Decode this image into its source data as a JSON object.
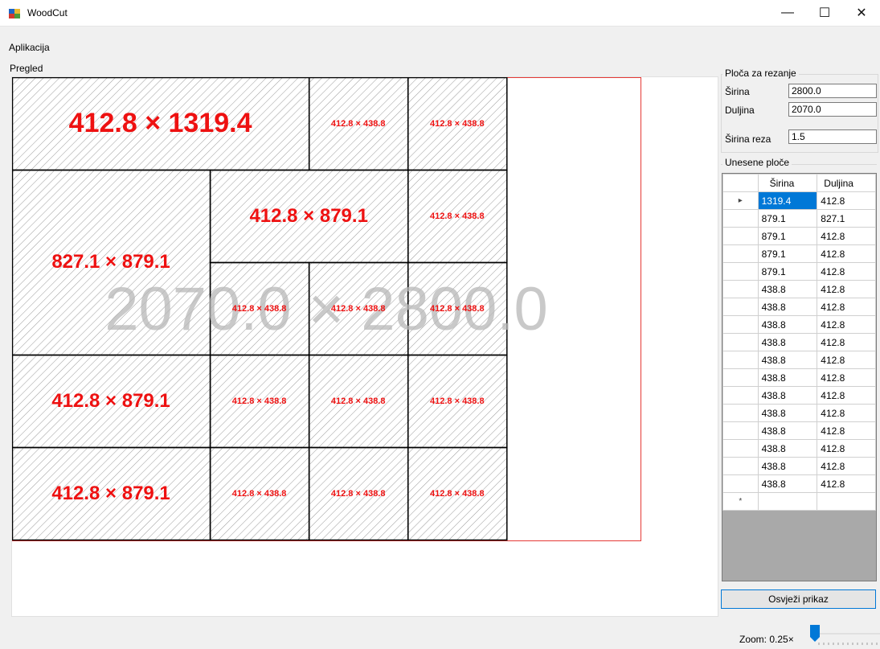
{
  "window": {
    "title": "WoodCut",
    "controls": [
      "—",
      "☐",
      "✕"
    ]
  },
  "menu": {
    "items": [
      "Aplikacija"
    ]
  },
  "preview": {
    "group_label": "Pregled",
    "board_label": "2070.0 × 2800.0",
    "pieces": [
      {
        "label": "412.8 × 1319.4",
        "size": "large"
      },
      {
        "label": "412.8 × 438.8",
        "size": "small"
      },
      {
        "label": "412.8 × 438.8",
        "size": "small"
      },
      {
        "label": "827.1 × 879.1",
        "size": "medium"
      },
      {
        "label": "412.8 × 879.1",
        "size": "medium"
      },
      {
        "label": "412.8 × 438.8",
        "size": "small"
      },
      {
        "label": "412.8 × 438.8",
        "size": "small"
      },
      {
        "label": "412.8 × 438.8",
        "size": "small"
      },
      {
        "label": "412.8 × 438.8",
        "size": "small"
      },
      {
        "label": "412.8 × 879.1",
        "size": "medium"
      },
      {
        "label": "412.8 × 438.8",
        "size": "small"
      },
      {
        "label": "412.8 × 438.8",
        "size": "small"
      },
      {
        "label": "412.8 × 438.8",
        "size": "small"
      },
      {
        "label": "412.8 × 879.1",
        "size": "medium"
      },
      {
        "label": "412.8 × 438.8",
        "size": "small"
      },
      {
        "label": "412.8 × 438.8",
        "size": "small"
      },
      {
        "label": "412.8 × 438.8",
        "size": "small"
      }
    ]
  },
  "board_settings": {
    "group_label": "Ploča za rezanje",
    "width_label": "Širina",
    "width_value": "2800.0",
    "length_label": "Duljina",
    "length_value": "2070.0",
    "kerf_label": "Širina reza",
    "kerf_value": "1.5"
  },
  "pieces_table": {
    "group_label": "Unesene ploče",
    "columns": [
      "Širina",
      "Duljina"
    ],
    "selected_marker": "▸",
    "new_row_marker": "*",
    "rows": [
      [
        "1319.4",
        "412.8"
      ],
      [
        "879.1",
        "827.1"
      ],
      [
        "879.1",
        "412.8"
      ],
      [
        "879.1",
        "412.8"
      ],
      [
        "879.1",
        "412.8"
      ],
      [
        "438.8",
        "412.8"
      ],
      [
        "438.8",
        "412.8"
      ],
      [
        "438.8",
        "412.8"
      ],
      [
        "438.8",
        "412.8"
      ],
      [
        "438.8",
        "412.8"
      ],
      [
        "438.8",
        "412.8"
      ],
      [
        "438.8",
        "412.8"
      ],
      [
        "438.8",
        "412.8"
      ],
      [
        "438.8",
        "412.8"
      ],
      [
        "438.8",
        "412.8"
      ],
      [
        "438.8",
        "412.8"
      ],
      [
        "438.8",
        "412.8"
      ]
    ]
  },
  "actions": {
    "refresh_label": "Osvježi prikaz"
  },
  "zoom": {
    "label": "Zoom: 0.25×",
    "value": 0.25,
    "slider_position": 0
  },
  "colors": {
    "board_outline": "#e53935",
    "piece_label": "#ee1111",
    "hatch": "#9a9a9a",
    "selection": "#0078d7"
  }
}
